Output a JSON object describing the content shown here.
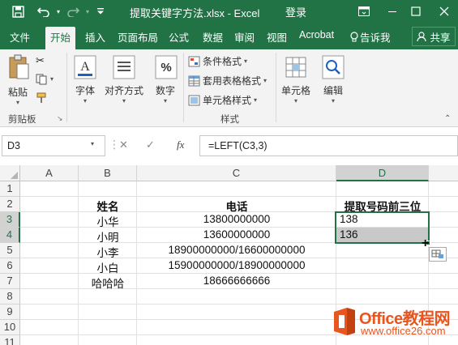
{
  "titlebar": {
    "document_title": "提取关键字方法.xlsx  -  Excel",
    "login_label": "登录",
    "icons": [
      "save-icon",
      "undo-icon",
      "redo-icon",
      "customize-icon",
      "ribbon-display-icon",
      "minimize-icon",
      "maximize-icon",
      "close-icon"
    ]
  },
  "tabs": [
    "文件",
    "开始",
    "插入",
    "页面布局",
    "公式",
    "数据",
    "审阅",
    "视图",
    "Acrobat",
    "告诉我",
    "共享"
  ],
  "active_tab": "开始",
  "ribbon": {
    "paste": "粘贴",
    "clipboard_group": "剪贴板",
    "font": "字体",
    "alignment": "对齐方式",
    "number": "数字",
    "conditional_format": "条件格式",
    "table_format": "套用表格格式",
    "cell_styles": "单元格样式",
    "styles_group": "样式",
    "cells": "单元格",
    "editing": "编辑"
  },
  "formula_bar": {
    "name_box": "D3",
    "fx": "fx",
    "formula": "=LEFT(C3,3)"
  },
  "sheet": {
    "columns": [
      "A",
      "B",
      "C",
      "D"
    ],
    "rows": [
      "1",
      "2",
      "3",
      "4",
      "5",
      "6",
      "7",
      "8",
      "9",
      "10",
      "11"
    ],
    "header_row": {
      "name": "姓名",
      "phone": "电话",
      "prefix": "提取号码前三位"
    },
    "data": [
      {
        "name": "小华",
        "phone": "13800000000",
        "prefix": "138"
      },
      {
        "name": "小明",
        "phone": "13600000000",
        "prefix": "136"
      },
      {
        "name": "小李",
        "phone": "18900000000/16600000000",
        "prefix": ""
      },
      {
        "name": "小白",
        "phone": "15900000000/18900000000",
        "prefix": ""
      },
      {
        "name": "哈哈哈",
        "phone": "18666666666",
        "prefix": ""
      }
    ]
  },
  "watermark": {
    "main": "Office教程网",
    "url": "www.office26.com"
  },
  "colors": {
    "excel_green": "#217346",
    "watermark_orange": "#e8551f"
  }
}
